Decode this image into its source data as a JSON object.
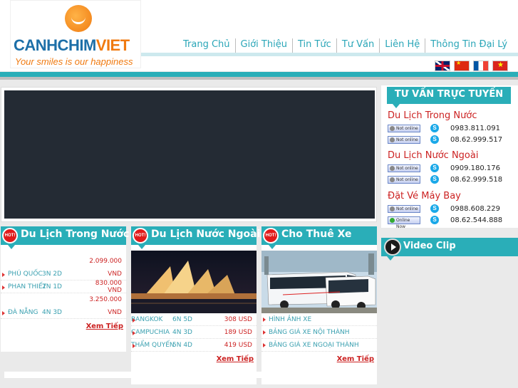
{
  "brand": {
    "name_part1": "CANHCHIM",
    "name_part2": "VIET",
    "slogan": "Your smiles is our happiness"
  },
  "nav": {
    "items": [
      "Trang Chủ",
      "Giới Thiệu",
      "Tin Tức",
      "Tư Vấn",
      "Liên Hệ",
      "Thông Tin Đại Lý"
    ]
  },
  "languages": [
    "english-flag",
    "china-flag",
    "france-flag",
    "vietnam-flag"
  ],
  "colors": {
    "accent": "#2aaeb8",
    "price": "#cc2222",
    "link": "#3aa0b0"
  },
  "domestic": {
    "badge": "HOT!",
    "title": "Du Lịch Trong Nước",
    "rows": [
      {
        "place": "",
        "duration": "",
        "price": "2.099.000"
      },
      {
        "place": "PHÚ QUỐC",
        "duration": "3N 2D",
        "price": "VND"
      },
      {
        "place": "PHAN THIẾT",
        "duration": "2N 1D",
        "price": "830.000 VND"
      },
      {
        "place": "",
        "duration": "",
        "price": "3.250.000"
      },
      {
        "place": "ĐÀ NẴNG",
        "duration": "4N 3D",
        "price": "VND"
      }
    ],
    "more": "Xem Tiếp"
  },
  "international": {
    "badge": "HOT!",
    "title": "Du Lịch Nước Ngoài",
    "rows": [
      {
        "place": "BANGKOK",
        "duration": "6N 5D",
        "price": "308 USD"
      },
      {
        "place": "CAMPUCHIA",
        "duration": "4N 3D",
        "price": "189 USD"
      },
      {
        "place": "THẨM QUYẾN",
        "duration": "5N 4D",
        "price": "419 USD"
      }
    ],
    "more": "Xem Tiếp"
  },
  "rental": {
    "badge": "HOT!",
    "title": "Cho Thuê Xe",
    "links": [
      "HÌNH ẢNH XE",
      "BẢNG GIÁ XE NỘI THÀNH",
      "BẢNG GIÁ XE NGOẠI THÀNH"
    ],
    "more": "Xem Tiếp"
  },
  "support": {
    "title": "TƯ VẤN TRỰC TUYẾN",
    "groups": [
      {
        "title": "Du Lịch Trong Nước",
        "rows": [
          {
            "status": "Not online",
            "phone": "0983.811.091"
          },
          {
            "status": "Not online",
            "phone": "08.62.999.517"
          }
        ]
      },
      {
        "title": "Du Lịch Nước Ngoài",
        "rows": [
          {
            "status": "Not online",
            "phone": "0909.180.176"
          },
          {
            "status": "Not online",
            "phone": "08.62.999.518"
          }
        ]
      },
      {
        "title": "Đặt Vé Máy Bay",
        "rows": [
          {
            "status": "Not online",
            "phone": "0988.608.229"
          },
          {
            "status": "Online Now",
            "phone": "08.62.544.888"
          }
        ]
      }
    ]
  },
  "video": {
    "title": "Video Clip"
  }
}
